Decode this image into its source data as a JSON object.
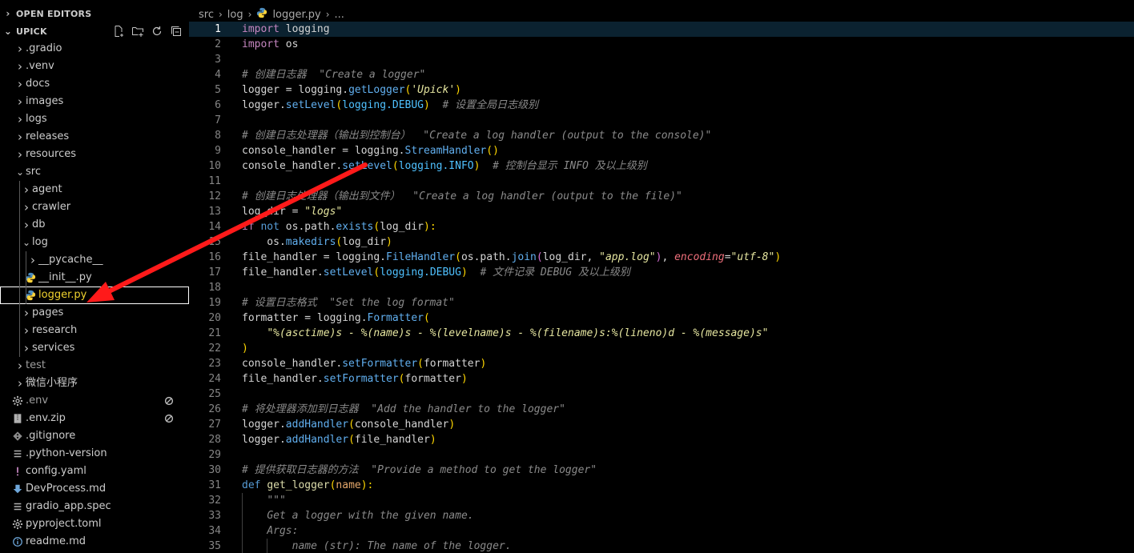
{
  "explorer": {
    "open_editors_label": "OPEN EDITORS",
    "project_label": "UPICK",
    "action_icons": [
      "new-file-icon",
      "new-folder-icon",
      "refresh-icon",
      "collapse-all-icon"
    ],
    "tree": [
      {
        "name": "tree-folder-gradio",
        "label": ".gradio",
        "type": "folder",
        "depth": 0,
        "expanded": false
      },
      {
        "name": "tree-folder-venv",
        "label": ".venv",
        "type": "folder",
        "depth": 0,
        "expanded": false
      },
      {
        "name": "tree-folder-docs",
        "label": "docs",
        "type": "folder",
        "depth": 0,
        "expanded": false
      },
      {
        "name": "tree-folder-images",
        "label": "images",
        "type": "folder",
        "depth": 0,
        "expanded": false
      },
      {
        "name": "tree-folder-logs",
        "label": "logs",
        "type": "folder",
        "depth": 0,
        "expanded": false
      },
      {
        "name": "tree-folder-releases",
        "label": "releases",
        "type": "folder",
        "depth": 0,
        "expanded": false
      },
      {
        "name": "tree-folder-resources",
        "label": "resources",
        "type": "folder",
        "depth": 0,
        "expanded": false
      },
      {
        "name": "tree-folder-src",
        "label": "src",
        "type": "folder",
        "depth": 0,
        "expanded": true
      },
      {
        "name": "tree-folder-agent",
        "label": "agent",
        "type": "folder",
        "depth": 1,
        "expanded": false
      },
      {
        "name": "tree-folder-crawler",
        "label": "crawler",
        "type": "folder",
        "depth": 1,
        "expanded": false
      },
      {
        "name": "tree-folder-db",
        "label": "db",
        "type": "folder",
        "depth": 1,
        "expanded": false
      },
      {
        "name": "tree-folder-log",
        "label": "log",
        "type": "folder",
        "depth": 1,
        "expanded": true
      },
      {
        "name": "tree-folder-pycache",
        "label": "__pycache__",
        "type": "folder",
        "depth": 2,
        "expanded": false
      },
      {
        "name": "tree-file-init-py",
        "label": "__init__.py",
        "type": "py",
        "depth": 2
      },
      {
        "name": "tree-file-logger-py",
        "label": "logger.py",
        "type": "py",
        "depth": 2,
        "selected": true
      },
      {
        "name": "tree-folder-pages",
        "label": "pages",
        "type": "folder",
        "depth": 1,
        "expanded": false
      },
      {
        "name": "tree-folder-research",
        "label": "research",
        "type": "folder",
        "depth": 1,
        "expanded": false
      },
      {
        "name": "tree-folder-services",
        "label": "services",
        "type": "folder",
        "depth": 1,
        "expanded": false
      },
      {
        "name": "tree-folder-test",
        "label": "test",
        "type": "folder",
        "depth": 0,
        "expanded": false,
        "dim": true
      },
      {
        "name": "tree-folder-wechat-miniprogram",
        "label": "微信小程序",
        "type": "folder",
        "depth": 0,
        "expanded": false
      },
      {
        "name": "tree-file-env",
        "label": ".env",
        "type": "gear",
        "depth": 0,
        "dim": true,
        "deco": "ignored-icon"
      },
      {
        "name": "tree-file-env-zip",
        "label": ".env.zip",
        "type": "zip",
        "depth": 0,
        "deco": "ignored-icon"
      },
      {
        "name": "tree-file-gitignore",
        "label": ".gitignore",
        "type": "git",
        "depth": 0
      },
      {
        "name": "tree-file-python-version",
        "label": ".python-version",
        "type": "lines",
        "depth": 0
      },
      {
        "name": "tree-file-config-yaml",
        "label": "config.yaml",
        "type": "yaml",
        "depth": 0
      },
      {
        "name": "tree-file-devprocess-md",
        "label": "DevProcess.md",
        "type": "md",
        "depth": 0
      },
      {
        "name": "tree-file-gradio-app-spec",
        "label": "gradio_app.spec",
        "type": "lines",
        "depth": 0
      },
      {
        "name": "tree-file-pyproject-toml",
        "label": "pyproject.toml",
        "type": "gear",
        "depth": 0
      },
      {
        "name": "tree-file-readme-md",
        "label": "readme.md",
        "type": "info",
        "depth": 0
      }
    ]
  },
  "breadcrumb": [
    "src",
    "log",
    "logger.py",
    "..."
  ],
  "editor": {
    "current_line": 1,
    "lines": [
      [
        [
          "kw",
          "import"
        ],
        [
          "var",
          " logging"
        ]
      ],
      [
        [
          "kw",
          "import"
        ],
        [
          "var",
          " os"
        ]
      ],
      [],
      [
        [
          "cm",
          "# 创建日志器  \"Create a logger\""
        ]
      ],
      [
        [
          "var",
          "logger "
        ],
        [
          "var",
          "= "
        ],
        [
          "var",
          "logging."
        ],
        [
          "meth",
          "getLogger"
        ],
        [
          "par",
          "("
        ],
        [
          "str",
          "'Upick'"
        ],
        [
          "par",
          ")"
        ]
      ],
      [
        [
          "var",
          "logger."
        ],
        [
          "meth",
          "setLevel"
        ],
        [
          "par",
          "("
        ],
        [
          "attr",
          "logging.DEBUG"
        ],
        [
          "par",
          ")"
        ],
        [
          "var",
          "  "
        ],
        [
          "cm",
          "# 设置全局日志级别"
        ]
      ],
      [],
      [
        [
          "cm",
          "# 创建日志处理器（输出到控制台）  \"Create a log handler (output to the console)\""
        ]
      ],
      [
        [
          "var",
          "console_handler = logging."
        ],
        [
          "meth",
          "StreamHandler"
        ],
        [
          "par",
          "()"
        ]
      ],
      [
        [
          "var",
          "console_handler."
        ],
        [
          "meth",
          "setLevel"
        ],
        [
          "par",
          "("
        ],
        [
          "attr",
          "logging.INFO"
        ],
        [
          "par",
          ")"
        ],
        [
          "var",
          "  "
        ],
        [
          "cm",
          "# 控制台显示 INFO 及以上级别"
        ]
      ],
      [],
      [
        [
          "cm",
          "# 创建日志处理器（输出到文件）  \"Create a log handler (output to the file)\""
        ]
      ],
      [
        [
          "var",
          "log_dir = "
        ],
        [
          "str",
          "\"logs\""
        ]
      ],
      [
        [
          "kw",
          "if"
        ],
        [
          "var",
          " "
        ],
        [
          "kw2",
          "not"
        ],
        [
          "var",
          " os.path."
        ],
        [
          "meth",
          "exists"
        ],
        [
          "par",
          "("
        ],
        [
          "var",
          "log_dir"
        ],
        [
          "par",
          "):"
        ]
      ],
      [
        [
          "var",
          "    os."
        ],
        [
          "meth",
          "makedirs"
        ],
        [
          "par",
          "("
        ],
        [
          "var",
          "log_dir"
        ],
        [
          "par",
          ")"
        ]
      ],
      [
        [
          "var",
          "file_handler = logging."
        ],
        [
          "meth",
          "FileHandler"
        ],
        [
          "par",
          "("
        ],
        [
          "var",
          "os.path."
        ],
        [
          "meth",
          "join"
        ],
        [
          "par2",
          "("
        ],
        [
          "var",
          "log_dir, "
        ],
        [
          "str",
          "\"app.log\""
        ],
        [
          "par2",
          ")"
        ],
        [
          "var",
          ", "
        ],
        [
          "param",
          "encoding"
        ],
        [
          "var",
          "="
        ],
        [
          "str",
          "\"utf-8\""
        ],
        [
          "par",
          ")"
        ]
      ],
      [
        [
          "var",
          "file_handler."
        ],
        [
          "meth",
          "setLevel"
        ],
        [
          "par",
          "("
        ],
        [
          "attr",
          "logging.DEBUG"
        ],
        [
          "par",
          ")"
        ],
        [
          "var",
          "  "
        ],
        [
          "cm",
          "# 文件记录 DEBUG 及以上级别"
        ]
      ],
      [],
      [
        [
          "cm",
          "# 设置日志格式  \"Set the log format\""
        ]
      ],
      [
        [
          "var",
          "formatter = logging."
        ],
        [
          "meth",
          "Formatter"
        ],
        [
          "par",
          "("
        ]
      ],
      [
        [
          "var",
          "    "
        ],
        [
          "str",
          "\"%(asctime)s - %(name)s - %(levelname)s - %(filename)s:%(lineno)d - %(message)s\""
        ]
      ],
      [
        [
          "par",
          ")"
        ]
      ],
      [
        [
          "var",
          "console_handler."
        ],
        [
          "meth",
          "setFormatter"
        ],
        [
          "par",
          "("
        ],
        [
          "var",
          "formatter"
        ],
        [
          "par",
          ")"
        ]
      ],
      [
        [
          "var",
          "file_handler."
        ],
        [
          "meth",
          "setFormatter"
        ],
        [
          "par",
          "("
        ],
        [
          "var",
          "formatter"
        ],
        [
          "par",
          ")"
        ]
      ],
      [],
      [
        [
          "cm",
          "# 将处理器添加到日志器  \"Add the handler to the logger\""
        ]
      ],
      [
        [
          "var",
          "logger."
        ],
        [
          "meth",
          "addHandler"
        ],
        [
          "par",
          "("
        ],
        [
          "var",
          "console_handler"
        ],
        [
          "par",
          ")"
        ]
      ],
      [
        [
          "var",
          "logger."
        ],
        [
          "meth",
          "addHandler"
        ],
        [
          "par",
          "("
        ],
        [
          "var",
          "file_handler"
        ],
        [
          "par",
          ")"
        ]
      ],
      [],
      [
        [
          "cm",
          "# 提供获取日志器的方法  \"Provide a method to get the logger\""
        ]
      ],
      [
        [
          "kw2",
          "def"
        ],
        [
          "var",
          " "
        ],
        [
          "fn",
          "get_logger"
        ],
        [
          "par",
          "("
        ],
        [
          "pname",
          "name"
        ],
        [
          "par",
          "):"
        ]
      ],
      [
        [
          "var",
          "    "
        ],
        [
          "cm",
          "\"\"\""
        ]
      ],
      [
        [
          "var",
          "    "
        ],
        [
          "cm",
          "Get a logger with the given name."
        ]
      ],
      [
        [
          "var",
          "    "
        ],
        [
          "cm",
          "Args:"
        ]
      ],
      [
        [
          "var",
          "        "
        ],
        [
          "cm",
          "name (str): The name of the logger."
        ]
      ]
    ]
  }
}
